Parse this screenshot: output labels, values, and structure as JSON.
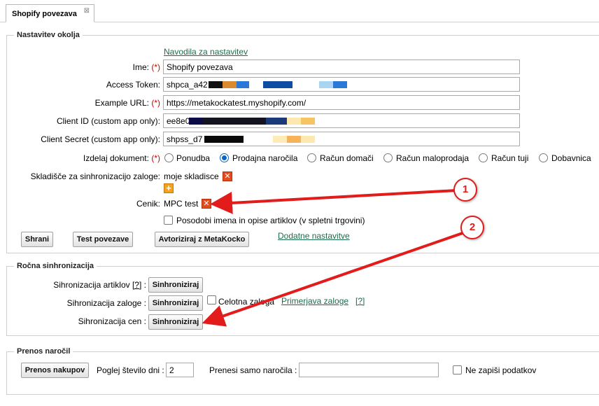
{
  "tab": {
    "label": "Shopify povezava",
    "close": "⊠"
  },
  "settings": {
    "legend": "Nastavitev okolja",
    "help_link": "Navodila za nastavitev",
    "name": {
      "label": "Ime:",
      "req": "(*)",
      "value": "Shopify povezava"
    },
    "token": {
      "label": "Access Token:",
      "value": "shpca_a42"
    },
    "url": {
      "label": "Example URL:",
      "req": "(*)",
      "value": "https://metakockatest.myshopify.com/"
    },
    "client_id": {
      "label": "Client ID (custom app only):",
      "value": "ee8e0"
    },
    "client_secret": {
      "label": "Client Secret (custom app only):",
      "value": "shpss_d7"
    },
    "document": {
      "label": "Izdelaj dokument:",
      "req": "(*)",
      "options": [
        "Ponudba",
        "Prodajna naročila",
        "Račun domači",
        "Račun maloprodaja",
        "Račun tuji",
        "Dobavnica"
      ],
      "selected": "Prodajna naročila"
    },
    "warehouse": {
      "label": "Skladišče za sinhronizacijo zaloge:",
      "value": "moje skladisce"
    },
    "pricelist": {
      "label": "Cenik:",
      "value": "MPC test"
    },
    "update_names": {
      "label": "Posodobi imena in opise artiklov (v spletni trgovini)",
      "checked": false
    },
    "buttons": {
      "save": "Shrani",
      "test": "Test povezave",
      "authorize": "Avtoriziraj z MetaKocko"
    },
    "extra_link": "Dodatne nastavitve"
  },
  "manual_sync": {
    "legend": "Ročna sinhronizacija",
    "articles": {
      "label": "Sihronizacija artiklov",
      "help": "[?]",
      "colon": ":",
      "button": "Sinhroniziraj"
    },
    "stock": {
      "label": "Sihronizacija zaloge :",
      "button": "Sinhroniziraj",
      "full_label": "Celotna zaloga",
      "compare_link": "Primerjava zaloge",
      "help": "[?]"
    },
    "prices": {
      "label": "Sihronizacija cen :",
      "button": "Sinhroniziraj"
    }
  },
  "orders": {
    "legend": "Prenos naročil",
    "button": "Prenos nakupov",
    "days_label": "Poglej število dni :",
    "days_value": "2",
    "only_orders_label": "Prenesi samo naročila :",
    "only_orders_value": "",
    "no_write_label": "Ne zapiši podatkov"
  },
  "annotations": {
    "one": "1",
    "two": "2",
    "color": "#e21b1b"
  },
  "icons": {
    "remove": "remove-icon",
    "add": "add-icon"
  }
}
